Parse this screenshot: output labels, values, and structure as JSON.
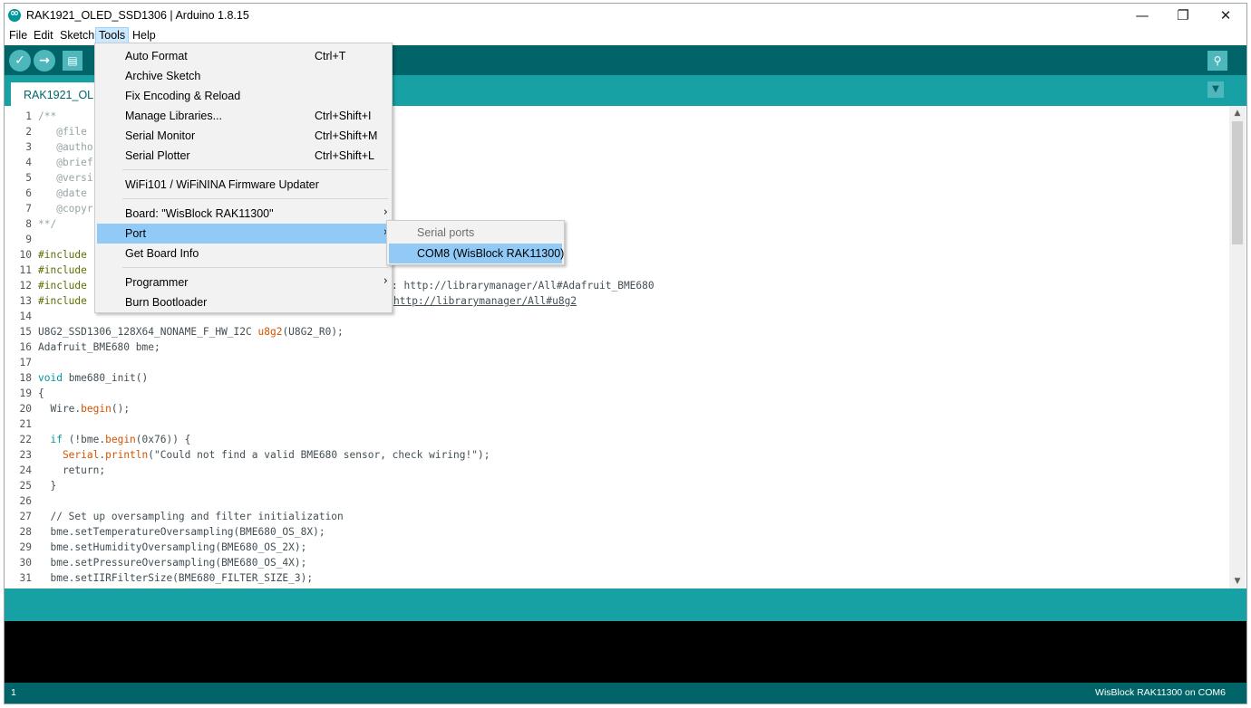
{
  "window": {
    "title": "RAK1921_OLED_SSD1306 | Arduino 1.8.15",
    "controls": {
      "minimize": "—",
      "restore": "❐",
      "close": "✕"
    }
  },
  "menubar": [
    "File",
    "Edit",
    "Sketch",
    "Tools",
    "Help"
  ],
  "toolbar": {
    "icons": [
      "verify-icon",
      "upload-icon",
      "new-icon",
      "serial-monitor-icon"
    ]
  },
  "tab": {
    "label": "RAK1921_OLED_SSD1306"
  },
  "tools_menu": {
    "items": [
      {
        "label": "Auto Format",
        "shortcut": "Ctrl+T"
      },
      {
        "label": "Archive Sketch",
        "shortcut": ""
      },
      {
        "label": "Fix Encoding & Reload",
        "shortcut": ""
      },
      {
        "label": "Manage Libraries...",
        "shortcut": "Ctrl+Shift+I"
      },
      {
        "label": "Serial Monitor",
        "shortcut": "Ctrl+Shift+M"
      },
      {
        "label": "Serial Plotter",
        "shortcut": "Ctrl+Shift+L"
      },
      {
        "label": "WiFi101 / WiFiNINA Firmware Updater",
        "shortcut": ""
      },
      {
        "label": "Board: \"WisBlock RAK11300\"",
        "shortcut": ""
      },
      {
        "label": "Port",
        "shortcut": ""
      },
      {
        "label": "Get Board Info",
        "shortcut": ""
      },
      {
        "label": "Programmer",
        "shortcut": ""
      },
      {
        "label": "Burn Bootloader",
        "shortcut": ""
      }
    ],
    "highlighted": "Port"
  },
  "port_submenu": {
    "header": "Serial ports",
    "selected": "COM8 (WisBlock RAK11300)"
  },
  "code": {
    "line_numbers": [
      "1",
      "2",
      "3",
      "4",
      "5",
      "6",
      "7",
      "8",
      "9",
      "10",
      "11",
      "12",
      "13",
      "14",
      "15",
      "16",
      "17",
      "18",
      "19",
      "20",
      "21",
      "22",
      "23",
      "24",
      "25",
      "26",
      "27",
      "28",
      "29",
      "30",
      "31"
    ],
    "l1": "/**",
    "l2": "   @file",
    "l3": "   @autho",
    "l4": "   @brief",
    "l5": "   @versi",
    "l6": "   @date",
    "l7": "   @copyr",
    "l8": "**/",
    "inc": "#include",
    "l12_tail": ": http://librarymanager/All#Adafruit_BME680",
    "l13_tail": "http://librarymanager/All#u8g2",
    "l15a": "U8G2_SSD1306_128X64_NONAME_F_HW_I2C ",
    "l15b": "u8g2",
    "l15c": "(U8G2_R0);",
    "l16": "Adafruit_BME680 bme;",
    "l18a": "void",
    "l18b": " bme680_init()",
    "l19": "{",
    "l20a": "  Wire.",
    "l20b": "begin",
    "l20c": "();",
    "l22a": "  if",
    "l22b": " (!bme.",
    "l22c": "begin",
    "l22d": "(0x76)) {",
    "l23a": "    Serial",
    "l23b": ".",
    "l23c": "println",
    "l23d": "(\"Could not find a valid BME680 sensor, check wiring!\");",
    "l24": "    return;",
    "l25": "  }",
    "l27": "  // Set up oversampling and filter initialization",
    "l28": "  bme.setTemperatureOversampling(BME680_OS_8X);",
    "l29": "  bme.setHumidityOversampling(BME680_OS_2X);",
    "l30": "  bme.setPressureOversampling(BME680_OS_4X);",
    "l31": "  bme.setIIRFilterSize(BME680_FILTER_SIZE_3);"
  },
  "status": {
    "line": "1",
    "board_port": "WisBlock RAK11300 on COM6"
  },
  "colors": {
    "teal_dark": "#006468",
    "teal": "#17a1a5",
    "menu_highlight": "#91c9f7"
  }
}
